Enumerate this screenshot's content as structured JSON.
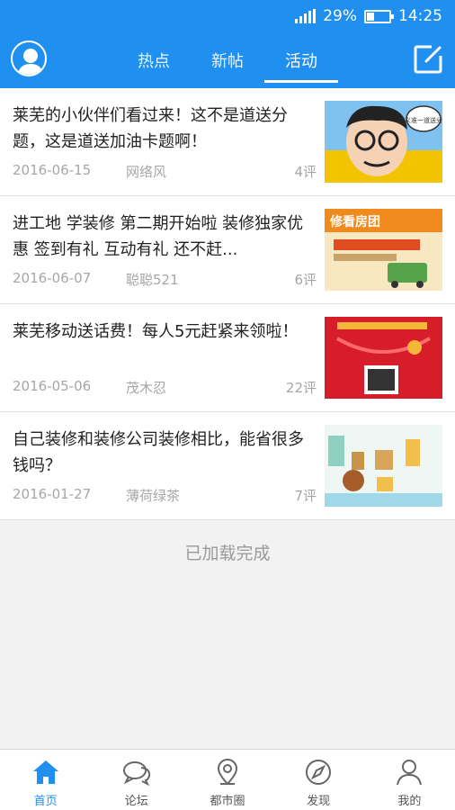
{
  "status_bar": {
    "battery": "29%",
    "time": "14:25",
    "battery_level": 0.29
  },
  "nav": {
    "tabs": [
      {
        "label": "热点",
        "active": false
      },
      {
        "label": "新帖",
        "active": false
      },
      {
        "label": "活动",
        "active": true
      }
    ],
    "avatar_icon": "user-avatar-icon",
    "edit_icon": "compose-icon"
  },
  "posts": [
    {
      "title": "莱芜的小伙伴们看过来！这不是道送分题，这是道送加油卡题啊！",
      "date": "2016-06-15",
      "author": "网络风",
      "comments": "4评",
      "thumb_text": "这义准一道送分题"
    },
    {
      "title": "进工地 学装修 第二期开始啦 装修独家优惠 签到有礼 互动有礼 还不赶...",
      "date": "2016-06-07",
      "author": "聪聪521",
      "comments": "6评",
      "thumb_text": "修看房团"
    },
    {
      "title": "莱芜移动送话费！每人5元赶紧来领啦！",
      "date": "2016-05-06",
      "author": "茂木忍",
      "comments": "22评",
      "thumb_text": ""
    },
    {
      "title": "自己装修和装修公司装修相比，能省很多钱吗？",
      "date": "2016-01-27",
      "author": "薄荷绿茶",
      "comments": "7评",
      "thumb_text": ""
    }
  ],
  "footer": {
    "loaded_text": "已加载完成"
  },
  "tab_bar": [
    {
      "label": "首页",
      "icon": "home-icon",
      "active": true
    },
    {
      "label": "论坛",
      "icon": "forum-icon",
      "active": false
    },
    {
      "label": "都市圈",
      "icon": "location-icon",
      "active": false
    },
    {
      "label": "发现",
      "icon": "compass-icon",
      "active": false
    },
    {
      "label": "我的",
      "icon": "profile-icon",
      "active": false
    }
  ],
  "colors": {
    "primary": "#1f8ff0",
    "text": "#222222",
    "meta": "#a6a6a6"
  }
}
